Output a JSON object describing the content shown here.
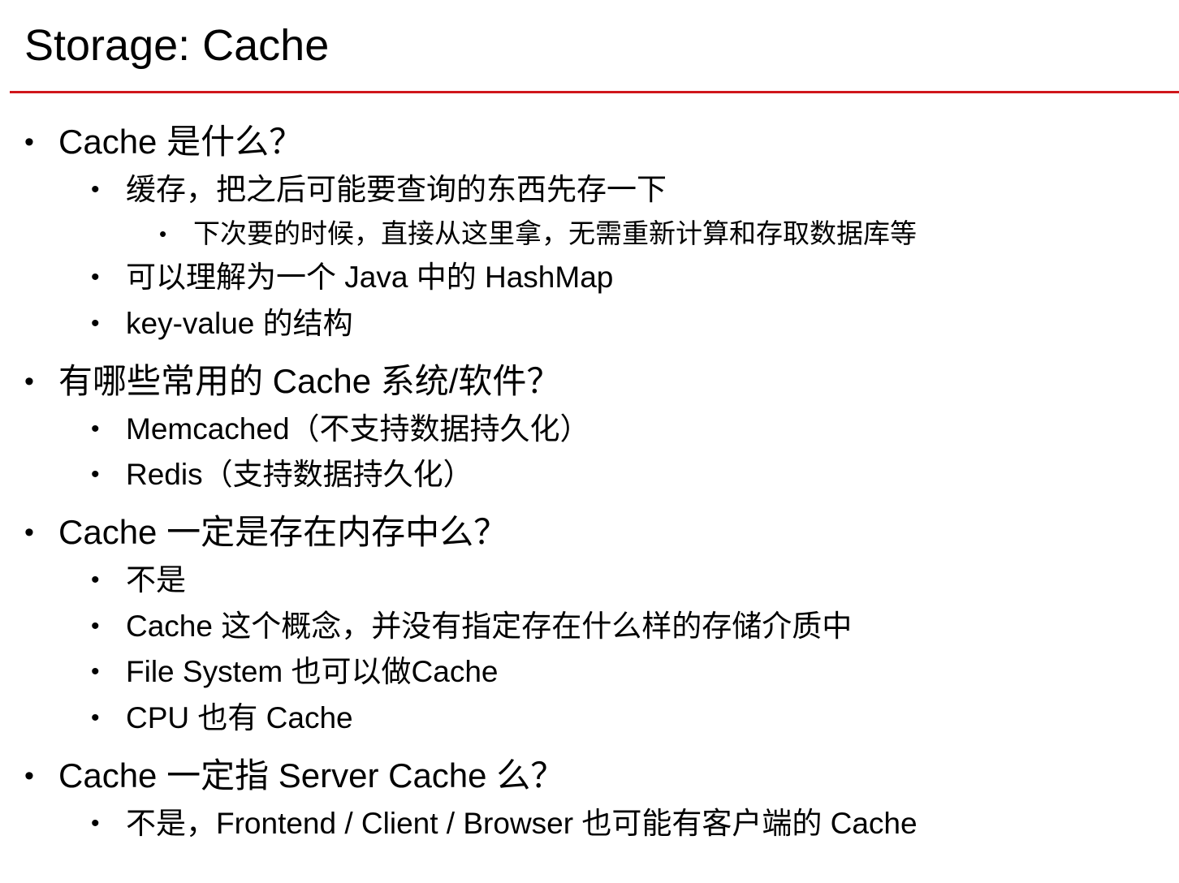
{
  "title": "Storage: Cache",
  "bullet_glyph": "•",
  "colors": {
    "rule": "#d0161b",
    "text": "#000000",
    "background": "#ffffff"
  },
  "items": [
    {
      "level": 1,
      "text": "Cache 是什么？"
    },
    {
      "level": 2,
      "text": "缓存，把之后可能要查询的东西先存一下"
    },
    {
      "level": 3,
      "text": "下次要的时候，直接从这里拿，无需重新计算和存取数据库等"
    },
    {
      "level": 2,
      "text": "可以理解为一个 Java 中的 HashMap"
    },
    {
      "level": 2,
      "text": "key-value 的结构"
    },
    {
      "level": 1,
      "text": "有哪些常用的 Cache 系统/软件？"
    },
    {
      "level": 2,
      "text": "Memcached（不支持数据持久化）"
    },
    {
      "level": 2,
      "text": "Redis（支持数据持久化）"
    },
    {
      "level": 1,
      "text": "Cache 一定是存在内存中么？"
    },
    {
      "level": 2,
      "text": "不是"
    },
    {
      "level": 2,
      "text": "Cache 这个概念，并没有指定存在什么样的存储介质中"
    },
    {
      "level": 2,
      "text": "File System 也可以做Cache"
    },
    {
      "level": 2,
      "text": "CPU 也有 Cache"
    },
    {
      "level": 1,
      "text": "Cache 一定指 Server Cache 么？"
    },
    {
      "level": 2,
      "text": "不是，Frontend / Client / Browser 也可能有客户端的 Cache"
    }
  ]
}
